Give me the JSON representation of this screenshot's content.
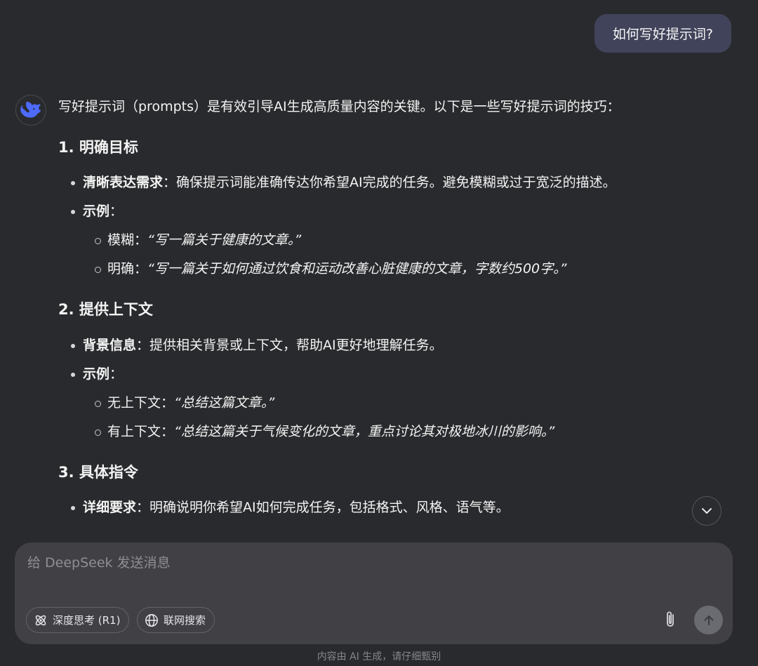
{
  "user_message": "如何写好提示词?",
  "answer": {
    "intro": "写好提示词（prompts）是有效引导AI生成高质量内容的关键。以下是一些写好提示词的技巧：",
    "sections": [
      {
        "title": "1. 明确目标",
        "bullets": [
          {
            "label": "清晰表达需求",
            "text": "：确保提示词能准确传达你希望AI完成的任务。避免模糊或过于宽泛的描述。"
          },
          {
            "label": "示例",
            "text": "："
          }
        ],
        "examples": [
          {
            "label": "模糊：",
            "text": "“写一篇关于健康的文章。”"
          },
          {
            "label": "明确：",
            "text": "“写一篇关于如何通过饮食和运动改善心脏健康的文章，字数约500字。”"
          }
        ]
      },
      {
        "title": "2. 提供上下文",
        "bullets": [
          {
            "label": "背景信息",
            "text": "：提供相关背景或上下文，帮助AI更好地理解任务。"
          },
          {
            "label": "示例",
            "text": "："
          }
        ],
        "examples": [
          {
            "label": "无上下文：",
            "text": "“总结这篇文章。”"
          },
          {
            "label": "有上下文：",
            "text": "“总结这篇关于气候变化的文章，重点讨论其对极地冰川的影响。”"
          }
        ]
      },
      {
        "title": "3. 具体指令",
        "bullets": [
          {
            "label": "详细要求",
            "text": "：明确说明你希望AI如何完成任务，包括格式、风格、语气等。"
          }
        ]
      }
    ]
  },
  "composer": {
    "placeholder": "给 DeepSeek 发送消息",
    "deep_think_label": "深度思考 (R1)",
    "web_search_label": "联网搜索"
  },
  "disclaimer": "内容由 AI 生成，请仔细甄别",
  "icons": {
    "avatar": "deepseek-whale-icon",
    "scroll": "chevron-down-icon",
    "deep_think": "atom-icon",
    "web_search": "globe-icon",
    "attach": "paperclip-icon",
    "send": "arrow-up-icon"
  },
  "colors": {
    "background": "#292a2d",
    "user_bubble": "#41435a",
    "composer": "#404045",
    "accent": "#4d6bfe"
  }
}
